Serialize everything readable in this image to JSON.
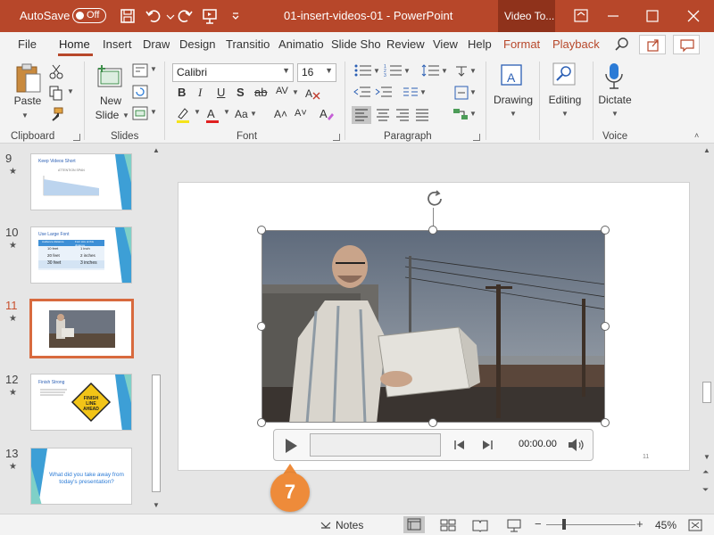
{
  "titlebar": {
    "autosave_label": "AutoSave",
    "autosave_state": "Off",
    "document_title": "01-insert-videos-01  -  PowerPoint",
    "contextual_tab": "Video To..."
  },
  "tabs": [
    "File",
    "Home",
    "Insert",
    "Draw",
    "Design",
    "Transitio",
    "Animatio",
    "Slide Sho",
    "Review",
    "View",
    "Help",
    "Format",
    "Playback"
  ],
  "ribbon": {
    "clipboard": {
      "label": "Clipboard",
      "paste": "Paste"
    },
    "slides": {
      "label": "Slides",
      "new_slide_line1": "New",
      "new_slide_line2": "Slide"
    },
    "font": {
      "label": "Font",
      "font_name": "Calibri",
      "font_size": "16"
    },
    "paragraph": {
      "label": "Paragraph"
    },
    "drawing": {
      "label": "Drawing"
    },
    "editing": {
      "label": "Editing"
    },
    "voice": {
      "label": "Voice",
      "dictate": "Dictate"
    }
  },
  "thumbnails": [
    {
      "number": "9",
      "title": "Keep Videos Short",
      "subtitle": "ATTENTION SPAN"
    },
    {
      "number": "10",
      "title": "Use Large Font",
      "table": [
        [
          "Audience distance",
          "Font size at this distance"
        ],
        [
          "10 feet",
          "1 inch"
        ],
        [
          "20 feet",
          "2 inches"
        ],
        [
          "30 feet",
          "3 inches"
        ]
      ]
    },
    {
      "number": "11",
      "selected": true
    },
    {
      "number": "12",
      "title": "Finish Strong",
      "sign_text": "FINISH LINE AHEAD"
    },
    {
      "number": "13",
      "body": "What did you take away from today's presentation?"
    }
  ],
  "slide": {
    "number": "11"
  },
  "video": {
    "time": "00:00.00"
  },
  "callout": "7",
  "status": {
    "notes": "Notes",
    "zoom": "45%"
  },
  "colors": {
    "accent": "#b7472a",
    "badge": "#ee8b3a",
    "selection": "#d86a3e"
  }
}
